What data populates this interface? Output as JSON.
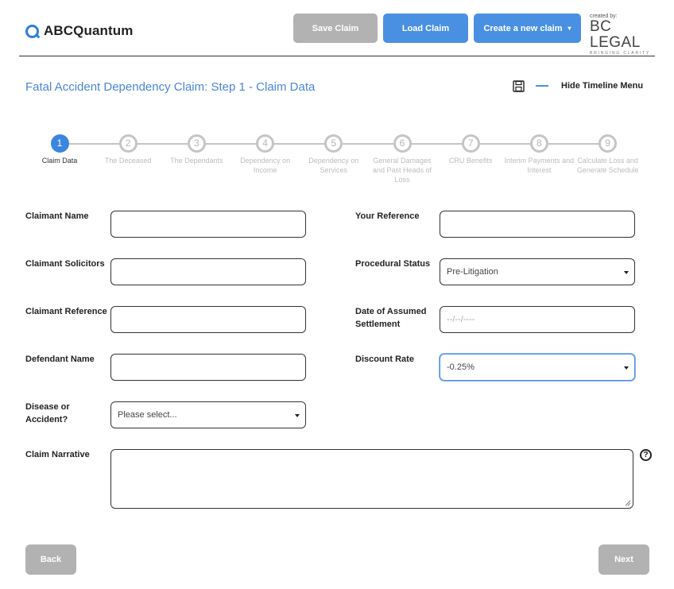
{
  "brand": {
    "name": "ABCQuantum"
  },
  "header": {
    "save_label": "Save Claim",
    "load_label": "Load Claim",
    "create_label": "Create a new claim",
    "created_by": "created by:",
    "partner_name": "BC LEGAL",
    "partner_tagline": "BRINGING CLARITY"
  },
  "page": {
    "title": "Fatal Accident Dependency Claim: Step 1 - Claim Data",
    "hide_menu_label": "Hide Timeline Menu"
  },
  "timeline": [
    {
      "num": "1",
      "label": "Claim Data",
      "active": true
    },
    {
      "num": "2",
      "label": "The Deceased",
      "active": false
    },
    {
      "num": "3",
      "label": "The Dependants",
      "active": false
    },
    {
      "num": "4",
      "label": "Dependency on Income",
      "active": false
    },
    {
      "num": "5",
      "label": "Dependency on Services",
      "active": false
    },
    {
      "num": "6",
      "label": "General Damages and Past Heads of Loss",
      "active": false
    },
    {
      "num": "7",
      "label": "CRU Benefits",
      "active": false
    },
    {
      "num": "8",
      "label": "Interim Payments and Interest",
      "active": false
    },
    {
      "num": "9",
      "label": "Calculate Loss and Generate Schedule",
      "active": false
    }
  ],
  "form": {
    "claimant_name_label": "Claimant Name",
    "claimant_name_value": "",
    "claimant_solicitors_label": "Claimant Solicitors",
    "claimant_solicitors_value": "",
    "claimant_reference_label": "Claimant Reference",
    "claimant_reference_value": "",
    "defendant_name_label": "Defendant Name",
    "defendant_name_value": "",
    "disease_label": "Disease or Accident?",
    "disease_value": "Please select...",
    "your_reference_label": "Your Reference",
    "your_reference_value": "",
    "procedural_status_label": "Procedural Status",
    "procedural_status_value": "Pre-Litigation",
    "date_settlement_label": "Date of Assumed Settlement",
    "date_settlement_placeholder": "--/--/----",
    "discount_rate_label": "Discount Rate",
    "discount_rate_value": "-0.25%",
    "narrative_label": "Claim Narrative",
    "narrative_value": ""
  },
  "footer": {
    "back_label": "Back",
    "next_label": "Next"
  },
  "colors": {
    "accent": "#4a90e2",
    "disabled": "#b2b2b2",
    "title": "#4a86d6"
  }
}
